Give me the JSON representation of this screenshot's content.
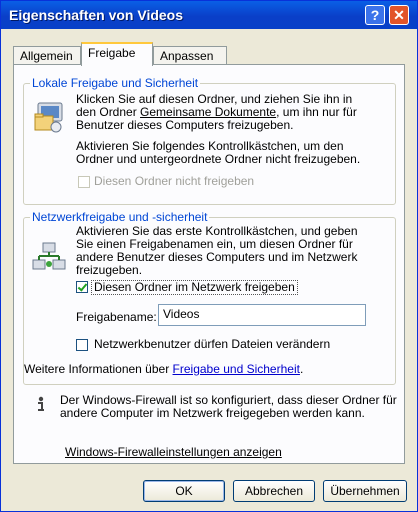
{
  "window": {
    "title": "Eigenschaften von Videos",
    "help_symbol": "?",
    "close_symbol": "✕"
  },
  "tabs": [
    {
      "label": "Allgemein",
      "selected": false
    },
    {
      "label": "Freigabe",
      "selected": true
    },
    {
      "label": "Anpassen",
      "selected": false
    }
  ],
  "local_sharing": {
    "group_label": "Lokale Freigabe und Sicherheit",
    "description_1a": "Klicken Sie auf diesen Ordner, und ziehen Sie ihn in",
    "description_1b_prefix": "den Ordner ",
    "description_1b_link": "Gemeinsame Dokumente",
    "description_1b_suffix": ", um ihn nur für",
    "description_1c": "Benutzer dieses Computers freizugeben.",
    "description_2a": "Aktivieren Sie folgendes Kontrollkästchen, um den",
    "description_2b": "Ordner und untergeordnete Ordner nicht freizugeben.",
    "checkbox_label": "Diesen Ordner nicht freigeben",
    "checkbox_checked": false,
    "checkbox_enabled": false
  },
  "network_sharing": {
    "group_label": "Netzwerkfreigabe und -sicherheit",
    "description_a": "Aktivieren Sie das erste Kontrollkästchen, und geben",
    "description_b": "Sie einen Freigabenamen ein, um diesen Ordner für",
    "description_c": "andere Benutzer dieses Computers und im Netzwerk",
    "description_d": "freizugeben.",
    "share_checkbox_label": "Diesen Ordner im Netzwerk freigeben",
    "share_checkbox_checked": true,
    "share_name_label": "Freigabename:",
    "share_name_value": "Videos",
    "modify_checkbox_label": "Netzwerkbenutzer dürfen Dateien verändern",
    "modify_checkbox_checked": false,
    "more_info_prefix": "Weitere Informationen über ",
    "more_info_link": "Freigabe und Sicherheit",
    "more_info_suffix": "."
  },
  "firewall": {
    "info_a": "Der Windows-Firewall ist so konfiguriert, dass dieser Ordner für",
    "info_b": "andere Computer im Netzwerk freigegeben werden kann.",
    "link": "Windows-Firewalleinstellungen anzeigen"
  },
  "buttons": {
    "ok": "OK",
    "cancel": "Abbrechen",
    "apply": "Übernehmen"
  }
}
